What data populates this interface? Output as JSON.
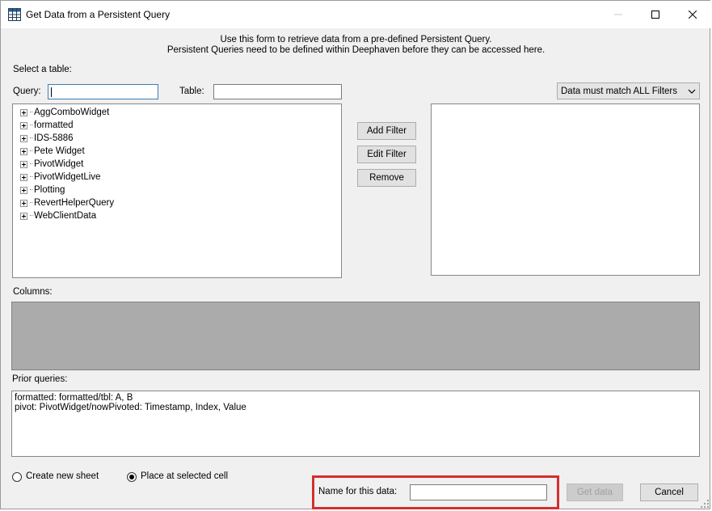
{
  "window": {
    "title": "Get Data from a Persistent Query",
    "controls": [
      "minimize",
      "maximize",
      "close"
    ]
  },
  "intro": {
    "line1": "Use this form to retrieve data from a pre-defined Persistent Query.",
    "line2": "Persistent Queries need to be defined within Deephaven before they can be accessed here."
  },
  "select_table_label": "Select a table:",
  "query_filter": {
    "label": "Query:",
    "value": ""
  },
  "table_filter": {
    "label": "Table:",
    "value": ""
  },
  "tree_items": [
    "AggComboWidget",
    "formatted",
    "IDS-5886",
    "Pete Widget",
    "PivotWidget",
    "PivotWidgetLive",
    "Plotting",
    "RevertHelperQuery",
    "WebClientData"
  ],
  "filter_buttons": {
    "add": "Add Filter",
    "edit": "Edit Filter",
    "remove": "Remove"
  },
  "filter_mode": {
    "selected": "Data must match ALL Filters"
  },
  "columns_label": "Columns:",
  "prior_queries_label": "Prior queries:",
  "prior_queries": [
    "formatted: formatted/tbl: A, B",
    "pivot: PivotWidget/nowPivoted: Timestamp, Index, Value"
  ],
  "destination": {
    "new_sheet": "Create new sheet",
    "selected_cell": "Place at selected cell",
    "selected": "selected_cell"
  },
  "name_field": {
    "label": "Name for this data:",
    "value": ""
  },
  "actions": {
    "get_data": "Get data",
    "cancel": "Cancel"
  },
  "colors": {
    "highlight": "#d32f2f",
    "columns_bg": "#ababab"
  }
}
